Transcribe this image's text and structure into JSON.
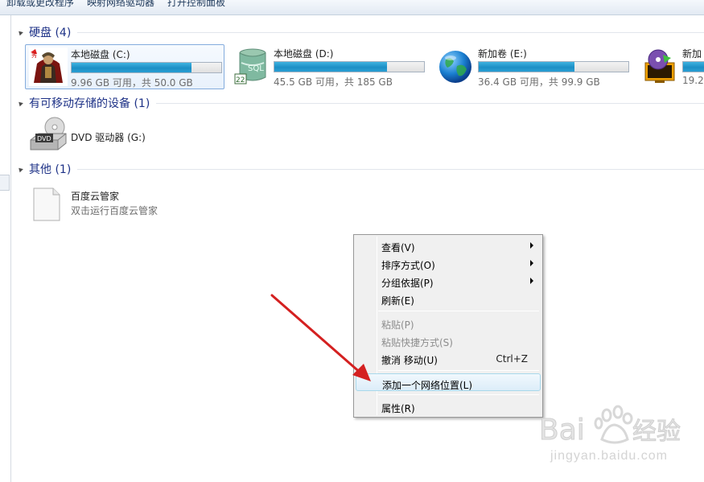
{
  "toolbar": {
    "items": [
      "卸载或更改程序",
      "映射网络驱动器",
      "打开控制面板"
    ]
  },
  "groups": {
    "hard_disks": "硬盘 (4)",
    "removable": "有可移动存储的设备 (1)",
    "other": "其他 (1)"
  },
  "drives": [
    {
      "name": "本地磁盘    (C:)",
      "free": "9.96 GB 可用，共 50.0 GB",
      "used_fraction": 0.8
    },
    {
      "name": "本地磁盘 (D:)",
      "free": "45.5 GB 可用，共 185 GB",
      "used_fraction": 0.75
    },
    {
      "name": "新加卷 (E:)",
      "free": "36.4 GB 可用，共 99.9 GB",
      "used_fraction": 0.64
    },
    {
      "name": "新加",
      "free": "19.2",
      "used_fraction": 0.9
    }
  ],
  "dvd": {
    "name": "DVD 驱动器 (G:)",
    "badge": "DVD"
  },
  "other_item": {
    "name": "百度云管家",
    "subtitle": "双击运行百度云管家"
  },
  "context_menu": {
    "view": "查看(V)",
    "sort": "排序方式(O)",
    "group": "分组依据(P)",
    "refresh": "刷新(E)",
    "paste": "粘贴(P)",
    "paste_shortcut": "粘贴快捷方式(S)",
    "undo_move": "撤消 移动(U)",
    "undo_shortcut": "Ctrl+Z",
    "add_network_location": "添加一个网络位置(L)",
    "properties": "属性(R)"
  },
  "watermark": {
    "site": "jingyan.baidu.com"
  },
  "colors": {
    "group_title": "#1e3287",
    "bar_fill": "#1c8fc5",
    "arrow": "#d42020"
  }
}
